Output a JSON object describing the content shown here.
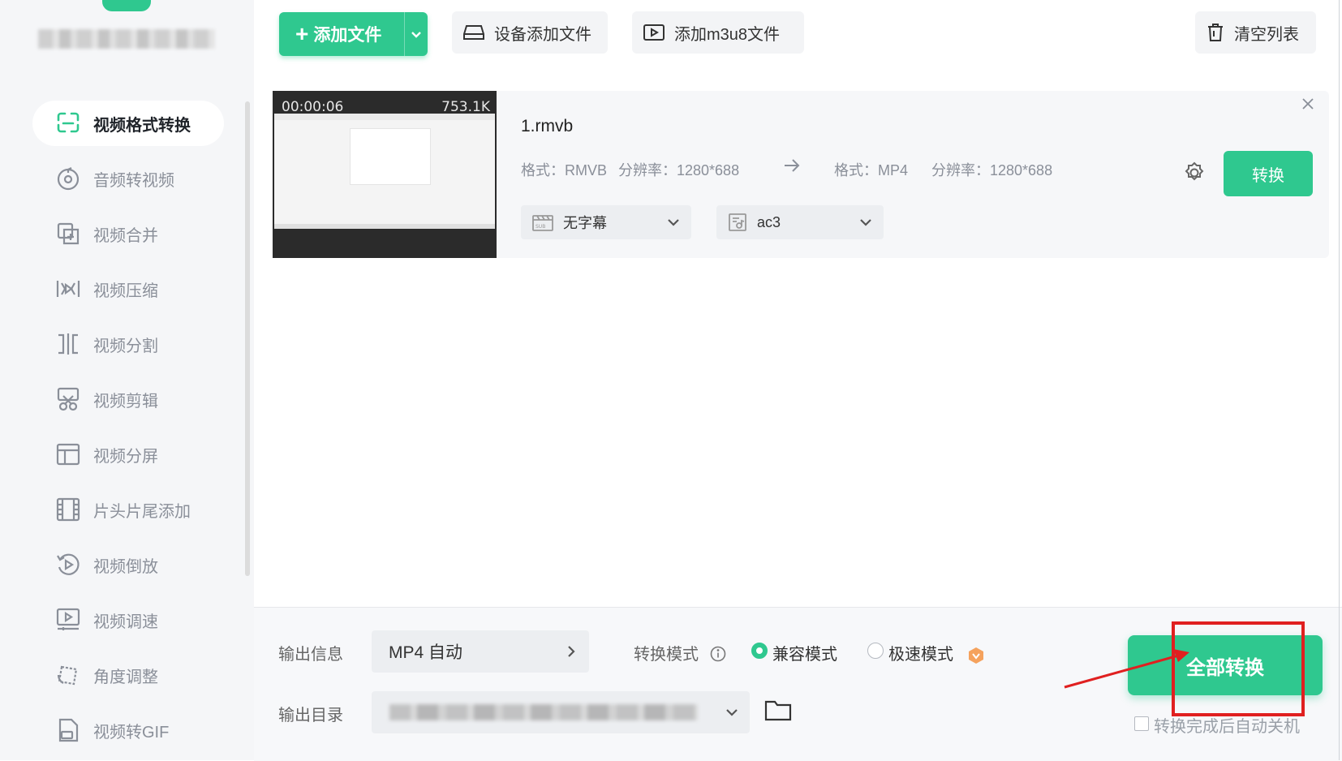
{
  "sidebar": {
    "items": [
      {
        "label": "视频格式转换",
        "icon": "format-convert-icon"
      },
      {
        "label": "音频转视频",
        "icon": "audio-to-video-icon"
      },
      {
        "label": "视频合并",
        "icon": "merge-icon"
      },
      {
        "label": "视频压缩",
        "icon": "compress-icon"
      },
      {
        "label": "视频分割",
        "icon": "split-icon"
      },
      {
        "label": "视频剪辑",
        "icon": "scissors-icon"
      },
      {
        "label": "视频分屏",
        "icon": "split-screen-icon"
      },
      {
        "label": "片头片尾添加",
        "icon": "film-icon"
      },
      {
        "label": "视频倒放",
        "icon": "reverse-icon"
      },
      {
        "label": "视频调速",
        "icon": "speed-icon"
      },
      {
        "label": "角度调整",
        "icon": "rotate-icon"
      },
      {
        "label": "视频转GIF",
        "icon": "gif-icon"
      }
    ],
    "active_index": 0
  },
  "toolbar": {
    "add_file": "添加文件",
    "device_add": "设备添加文件",
    "add_m3u8": "添加m3u8文件",
    "clear_list": "清空列表"
  },
  "file": {
    "duration": "00:00:06",
    "size": "753.1K",
    "name": "1.rmvb",
    "source_format": "格式：RMVB",
    "source_resolution": "分辨率：1280*688",
    "target_format": "格式：MP4",
    "target_resolution": "分辨率：1280*688",
    "convert_label": "转换",
    "subtitle": "无字幕",
    "audio": "ac3"
  },
  "bottom": {
    "output_info_label": "输出信息",
    "output_format": "MP4 自动",
    "convert_mode_label": "转换模式",
    "mode_compatible": "兼容模式",
    "mode_fast": "极速模式",
    "output_dir_label": "输出目录",
    "convert_all": "全部转换",
    "shutdown_label": "转换完成后自动关机"
  },
  "colors": {
    "accent": "#2fc88f",
    "highlight": "#e02020"
  }
}
